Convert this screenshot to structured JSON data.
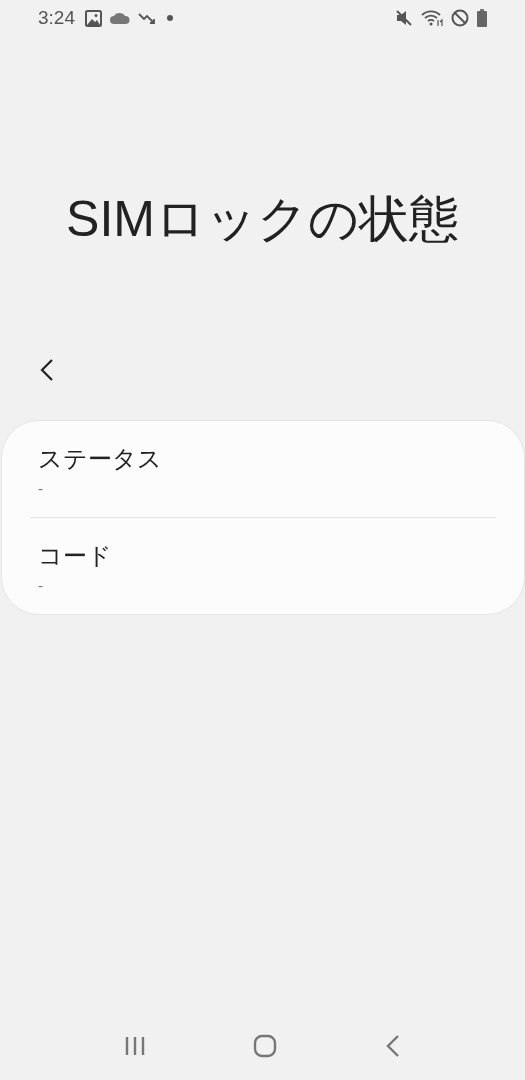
{
  "status_bar": {
    "time": "3:24"
  },
  "title": "SIMロックの状態",
  "items": [
    {
      "label": "ステータス",
      "value": "-"
    },
    {
      "label": "コード",
      "value": "-"
    }
  ]
}
